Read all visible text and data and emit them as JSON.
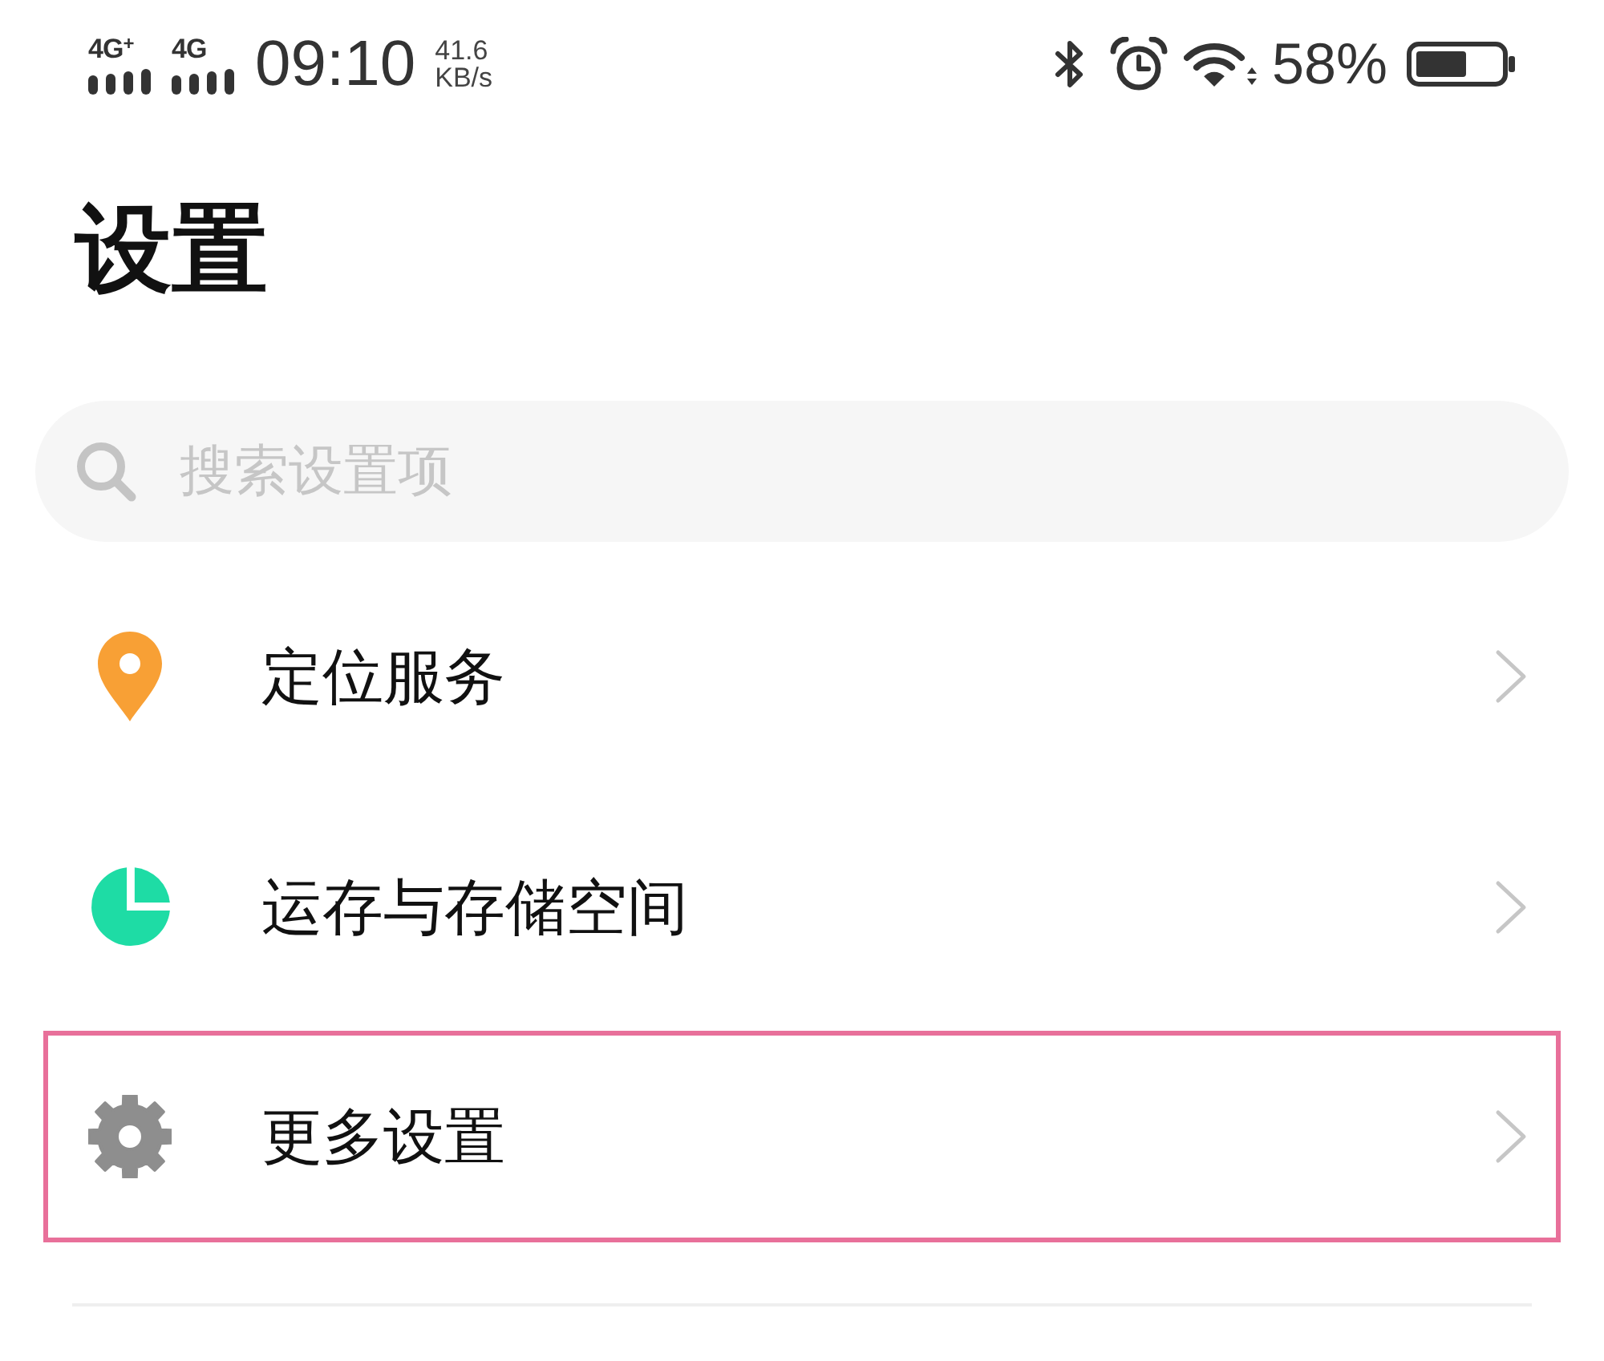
{
  "status_bar": {
    "signals": [
      {
        "label": "4G$^{+}$"
      },
      {
        "label": "4G"
      }
    ],
    "time": "09:10",
    "speed": {
      "value": "41.6",
      "unit": "KB/s"
    },
    "battery_text": "58%"
  },
  "title": "设置",
  "search": {
    "placeholder": "搜索设置项"
  },
  "items": [
    {
      "kind": "location",
      "label": "定位服务",
      "highlighted": false
    },
    {
      "kind": "storage",
      "label": "运存与存储空间",
      "highlighted": false
    },
    {
      "kind": "gear",
      "label": "更多设置",
      "highlighted": true
    }
  ]
}
